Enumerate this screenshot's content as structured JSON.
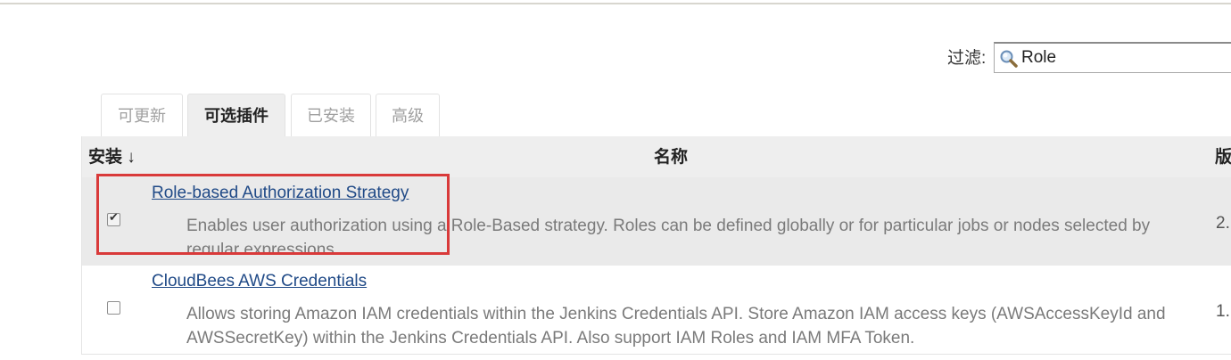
{
  "filter": {
    "label": "过滤:",
    "value": "Role",
    "icon": "magnifier-icon"
  },
  "tabs": [
    {
      "label": "可更新",
      "active": false
    },
    {
      "label": "可选插件",
      "active": true
    },
    {
      "label": "已安装",
      "active": false
    },
    {
      "label": "高级",
      "active": false
    }
  ],
  "table": {
    "headers": {
      "install": "安装 ↓",
      "name": "名称",
      "version": "版"
    },
    "rows": [
      {
        "checked": true,
        "name": "Role-based Authorization Strategy",
        "description": "Enables user authorization using a Role-Based strategy. Roles can be defined globally or for particular jobs or nodes selected by regular expressions.",
        "version": "2."
      },
      {
        "checked": false,
        "name": "CloudBees AWS Credentials",
        "description": "Allows storing Amazon IAM credentials within the Jenkins Credentials API. Store Amazon IAM access keys (AWSAccessKeyId and AWSSecretKey) within the Jenkins Credentials API. Also support IAM Roles and IAM MFA Token.",
        "version": "1."
      }
    ]
  },
  "colors": {
    "link": "#204a87",
    "highlight": "#d93a3a",
    "header_bg": "#eeeeee",
    "selected_row_bg": "#eaeaea"
  }
}
